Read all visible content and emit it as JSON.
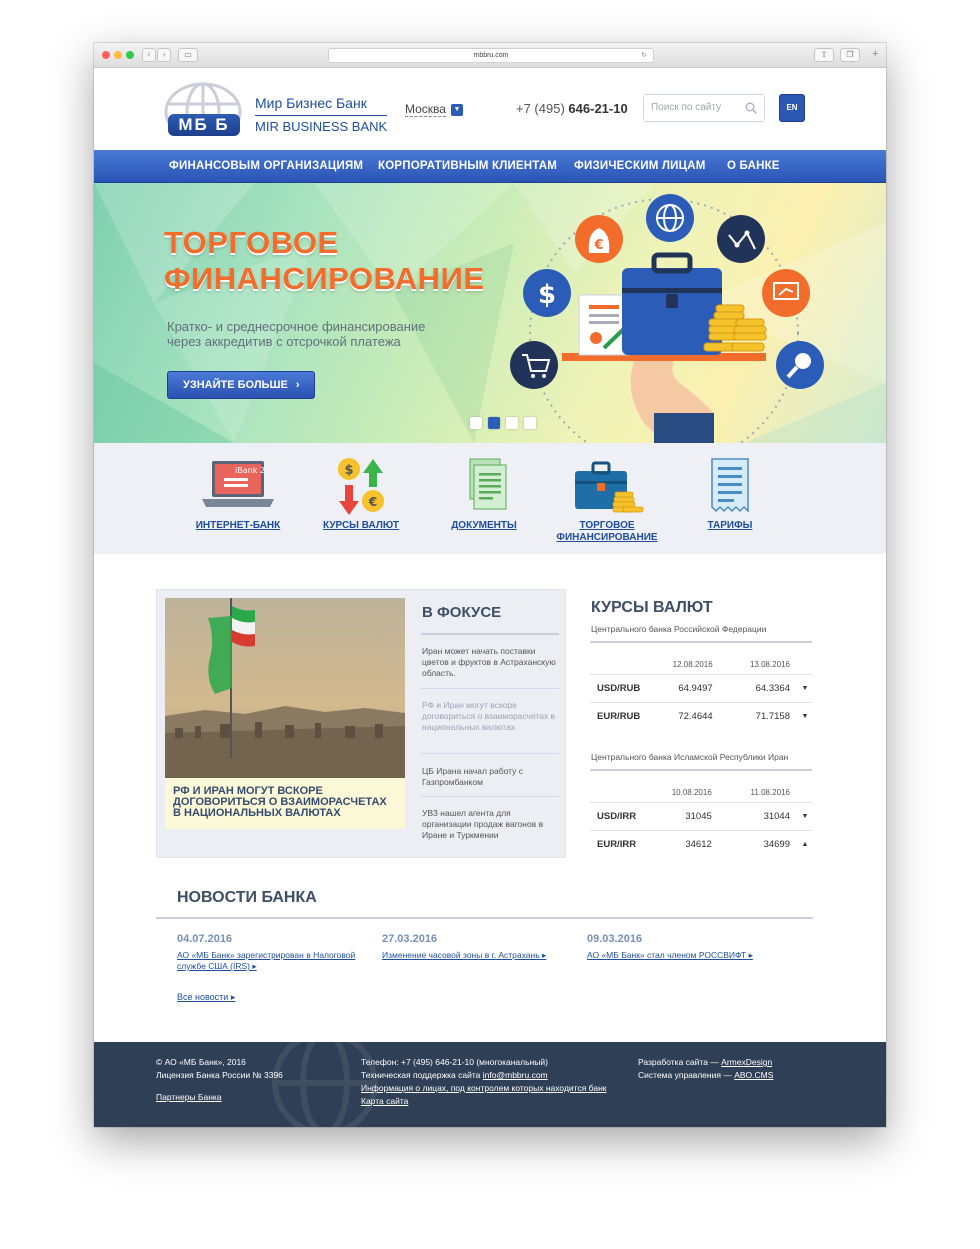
{
  "browser": {
    "url": "mbbru.com"
  },
  "header": {
    "logo_text": "МБ Б",
    "bank_name_ru": "Мир Бизнес Банк",
    "bank_name_en": "MIR BUSINESS BANK",
    "city": "Москва",
    "phone_prefix": "+7 (495)",
    "phone_number": "646-21-10",
    "search_placeholder": "Поиск по сайту",
    "lang_button": "EN"
  },
  "menu": {
    "items": [
      {
        "label": "ФИНАНСОВЫМ ОРГАНИЗАЦИЯМ"
      },
      {
        "label": "КОРПОРАТИВНЫМ КЛИЕНТАМ"
      },
      {
        "label": "ФИЗИЧЕСКИМ ЛИЦАМ"
      },
      {
        "label": "О БАНКЕ"
      }
    ]
  },
  "hero": {
    "title_line1": "ТОРГОВОЕ",
    "title_line2": "ФИНАНСИРОВАНИЕ",
    "subtitle_line1": "Кратко- и среднесрочное финансирование",
    "subtitle_line2": "через аккредитив с отсрочкой платежа",
    "button_label": "УЗНАЙТЕ БОЛЬШЕ",
    "slides_count": 4,
    "active_slide": 2
  },
  "quick_links": [
    {
      "label": "ИНТЕРНЕТ-БАНК",
      "icon": "laptop-icon",
      "icon_text": "iBank 2"
    },
    {
      "label": "КУРСЫ ВАЛЮТ",
      "icon": "currency-exchange-icon"
    },
    {
      "label": "ДОКУМЕНТЫ",
      "icon": "documents-icon"
    },
    {
      "label_line1": "ТОРГОВОЕ",
      "label_line2": "ФИНАНСИРОВАНИЕ",
      "icon": "briefcase-icon"
    },
    {
      "label": "ТАРИФЫ",
      "icon": "receipt-icon"
    }
  ],
  "focus": {
    "title": "В ФОКУСЕ",
    "photo_caption": "РФ И ИРАН МОГУТ ВСКОРЕ ДОГОВОРИТЬСЯ О ВЗАИМОРАСЧЕТАХ В НАЦИОНАЛЬНЫХ ВАЛЮТАХ",
    "items": [
      {
        "text": "Иран может начать поставки цветов и фруктов в Астраханскую область."
      },
      {
        "text": "РФ и Иран могут вскоре договориться о взаиморасчетах в национальных валютах"
      },
      {
        "text": "ЦБ Ирана начал работу с Газпромбанком"
      },
      {
        "text": "УВЗ нашел агента для организации продаж вагонов в Иране и Туркмении"
      }
    ]
  },
  "rates": {
    "title": "КУРСЫ ВАЛЮТ",
    "cbr": {
      "subtitle": "Центрального банка Российской Федерации",
      "date1": "12.08.2016",
      "date2": "13.08.2016",
      "rows": [
        {
          "pair": "USD/RUB",
          "v1": "64.9497",
          "v2": "64.3364",
          "trend": "down"
        },
        {
          "pair": "EUR/RUB",
          "v1": "72.4644",
          "v2": "71.7158",
          "trend": "down"
        }
      ]
    },
    "cbi": {
      "subtitle": "Центрального банка Исламской Республики Иран",
      "date1": "10.08.2016",
      "date2": "11.08.2016",
      "rows": [
        {
          "pair": "USD/IRR",
          "v1": "31045",
          "v2": "31044",
          "trend": "down"
        },
        {
          "pair": "EUR/IRR",
          "v1": "34612",
          "v2": "34699",
          "trend": "up"
        }
      ]
    },
    "trend_colors": {
      "down": "#e02626",
      "up": "#37a83a"
    }
  },
  "news": {
    "title": "НОВОСТИ БАНКА",
    "items": [
      {
        "date": "04.07.2016",
        "text": "АО «МБ Банк» зарегистрирован в Налоговой службе США (IRS)"
      },
      {
        "date": "27.03.2016",
        "text": "Изменение часовой зоны в г. Астрахань"
      },
      {
        "date": "09.03.2016",
        "text": "АО «МБ Банк» стал членом РОССВИФТ"
      }
    ],
    "all_news": "Все новости"
  },
  "footer": {
    "copyright": "© АО «МБ Банк», 2016",
    "license": "Лицензия Банка России № 3396",
    "partners": "Партнеры Банка",
    "phone_line": "Телефон: +7 (495) 646-21-10 (многоканальный)",
    "support_prefix": "Техническая поддержка сайта",
    "support_email": "info@mbbru.com",
    "control_info": "Информация о лицах, под контролем которых находится банк",
    "sitemap": "Карта сайта",
    "dev_prefix": "Разработка сайта —",
    "dev_name": "ArmexDesign",
    "cms_prefix": "Система управления —",
    "cms_name": "ABO.CMS"
  },
  "colors": {
    "brand_blue": "#2a5cb8",
    "menu_blue": "#3a68c8",
    "hero_orange": "#f26c2b",
    "footer_bg": "#2f3f55",
    "focus_caption_bg": "#fcf9d9"
  }
}
